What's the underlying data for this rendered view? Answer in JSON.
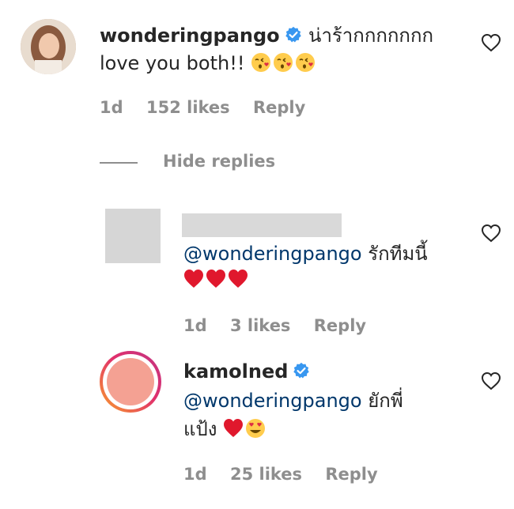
{
  "comments": [
    {
      "username": "wonderingpango",
      "verified": true,
      "text_after_name": "น่าร้ากกกกกกก",
      "text_line2": "love you both!!",
      "emoji": [
        "kissing-heart-icon",
        "kissing-heart-icon",
        "kissing-heart-icon"
      ],
      "time": "1d",
      "likes": "152 likes",
      "reply": "Reply"
    }
  ],
  "replies_toggle": {
    "label": "Hide replies"
  },
  "replies": [
    {
      "username": "",
      "mention": "@wonderingpango",
      "text": "รักทีมนี้",
      "emoji": [
        "red-heart-icon",
        "red-heart-icon",
        "red-heart-icon"
      ],
      "time": "1d",
      "likes": "3 likes",
      "reply": "Reply"
    },
    {
      "username": "kamolned",
      "verified": true,
      "mention": "@wonderingpango",
      "text": "ยักพี่",
      "text_line2": "แป้ง",
      "emoji": [
        "red-heart-icon",
        "heart-eyes-icon"
      ],
      "time": "1d",
      "likes": "25 likes",
      "reply": "Reply"
    }
  ],
  "colors": {
    "verified_blue": "#3897f0",
    "mention": "#00376b",
    "meta_gray": "#8e8e8e",
    "redacted_gray": "#d6d6d6"
  }
}
